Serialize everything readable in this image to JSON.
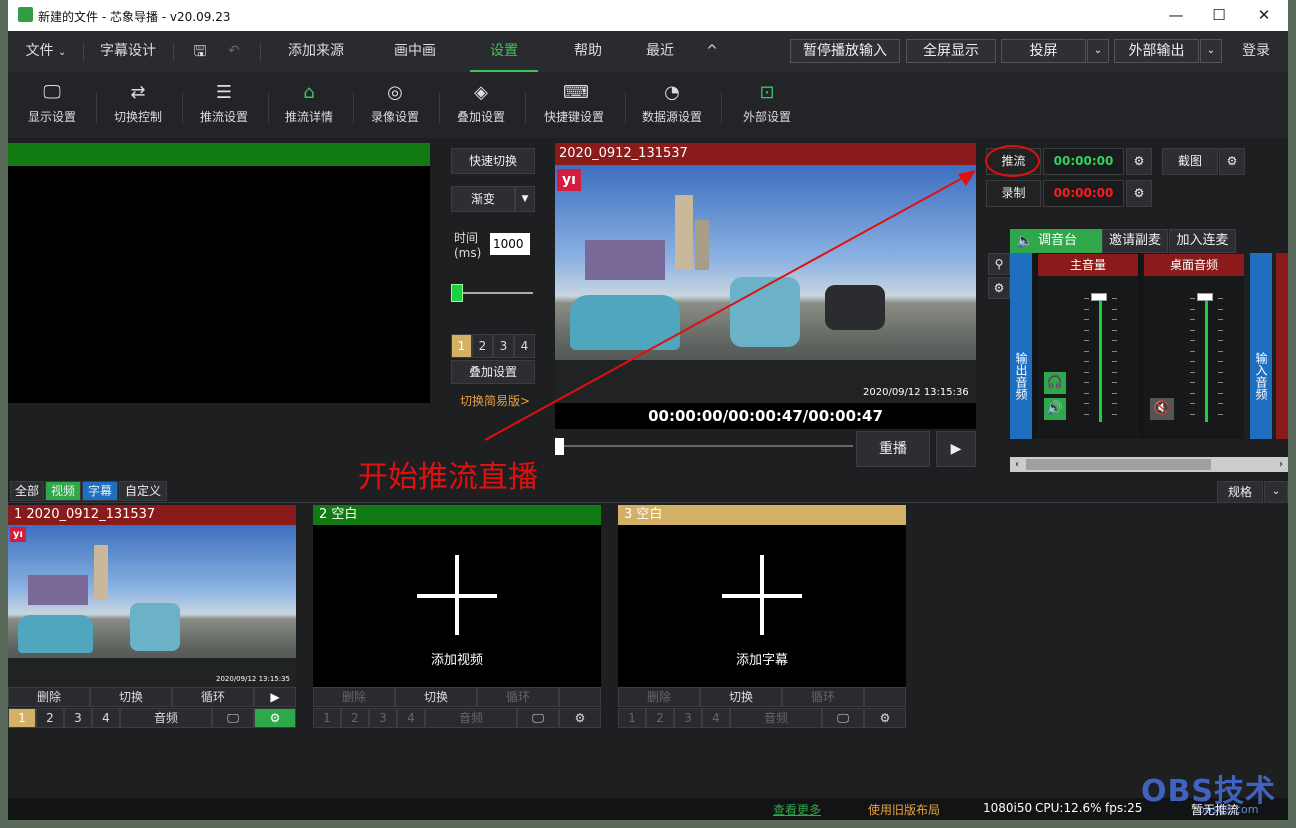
{
  "window": {
    "title": "新建的文件 - 芯象导播 - v20.09.23",
    "controls": [
      "—",
      "☐",
      "✕"
    ]
  },
  "menu": {
    "file": "文件",
    "subtitle_design": "字幕设计",
    "add_source": "添加来源",
    "pip": "画中画",
    "settings": "设置",
    "help": "帮助",
    "recent": "最近",
    "collapse": "^"
  },
  "top_buttons": {
    "pause_input": "暂停播放输入",
    "fullscreen": "全屏显示",
    "cast": "投屏",
    "external_output": "外部输出",
    "login": "登录"
  },
  "toolbar": [
    "显示设置",
    "切换控制",
    "推流设置",
    "推流详情",
    "录像设置",
    "叠加设置",
    "快捷键设置",
    "数据源设置",
    "外部设置"
  ],
  "switcher": {
    "quick_switch": "快速切换",
    "transition": "渐变",
    "time_label_1": "时间",
    "time_label_2": "(ms)",
    "time_value": "1000",
    "pages": [
      "1",
      "2",
      "3",
      "4"
    ],
    "overlay": "叠加设置",
    "simple_link": "切换简易版>"
  },
  "program": {
    "title": "2020_0912_131537",
    "timestamp": "2020/09/12 13:15:36",
    "timecode": "00:00:00/00:00:47/00:00:47",
    "replay": "重播",
    "play": "▶",
    "progress": 0
  },
  "stream": {
    "push_label": "推流",
    "push_time": "00:00:00",
    "record_label": "录制",
    "record_time": "00:00:00",
    "screenshot": "截图"
  },
  "audio": {
    "mixer_tab": "调音台",
    "invite_tab": "邀请副麦",
    "join_tab": "加入连麦",
    "output_audio": "输出音频",
    "input_audio": "输入音频",
    "master_label": "主音量",
    "desktop_label": "桌面音频",
    "master_level": 0.95,
    "desktop_level": 0.95
  },
  "annotation": {
    "text": "开始推流直播"
  },
  "filters": [
    "全部",
    "视频",
    "字幕",
    "自定义"
  ],
  "spec": "规格",
  "sources": [
    {
      "title": "1 2020_0912_131537",
      "label": "",
      "timestamp": "2020/09/12 13:15:35",
      "controls": [
        "删除",
        "切换",
        "循环",
        "▶"
      ],
      "pages": [
        "1",
        "2",
        "3",
        "4"
      ],
      "audio": "音频"
    },
    {
      "title": "2 空白",
      "label": "添加视频",
      "controls": [
        "删除",
        "切换",
        "循环",
        ""
      ],
      "pages": [
        "1",
        "2",
        "3",
        "4"
      ],
      "audio": "音频"
    },
    {
      "title": "3 空白",
      "label": "添加字幕",
      "controls": [
        "删除",
        "切换",
        "循环",
        ""
      ],
      "pages": [
        "1",
        "2",
        "3",
        "4"
      ],
      "audio": "音频"
    }
  ],
  "status": {
    "more": "查看更多",
    "old_layout": "使用旧版布局",
    "resolution": "1080i50",
    "cpu": "CPU:12.6%",
    "fps": "fps:25",
    "stream_state": "暂无推流"
  },
  "watermark": {
    "brand": "OBS技术",
    "site": "obs89.com"
  },
  "colors": {
    "accent_green": "#3dc45a",
    "program_red": "#8b1a1a",
    "preview_green": "#127a12",
    "blank3_gold": "#d2b066",
    "audio_blue": "#1e6fc0"
  }
}
